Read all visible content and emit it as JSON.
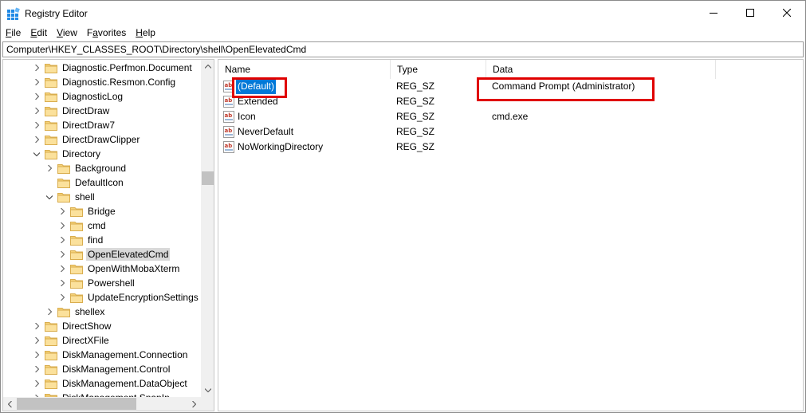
{
  "window": {
    "title": "Registry Editor"
  },
  "menu": [
    {
      "key": "F",
      "rest": "ile"
    },
    {
      "key": "E",
      "rest": "dit"
    },
    {
      "key": "V",
      "rest": "iew"
    },
    {
      "key": "",
      "pre": "F",
      "key2": "a",
      "rest": "vorites"
    },
    {
      "key": "H",
      "rest": "elp"
    }
  ],
  "address": {
    "path": "Computer\\HKEY_CLASSES_ROOT\\Directory\\shell\\OpenElevatedCmd"
  },
  "tree": {
    "items": [
      {
        "label": "Diagnostic.Perfmon.Document",
        "level": 0,
        "chevron": "right"
      },
      {
        "label": "Diagnostic.Resmon.Config",
        "level": 0,
        "chevron": "right"
      },
      {
        "label": "DiagnosticLog",
        "level": 0,
        "chevron": "right"
      },
      {
        "label": "DirectDraw",
        "level": 0,
        "chevron": "right"
      },
      {
        "label": "DirectDraw7",
        "level": 0,
        "chevron": "right"
      },
      {
        "label": "DirectDrawClipper",
        "level": 0,
        "chevron": "right"
      },
      {
        "label": "Directory",
        "level": 0,
        "chevron": "down"
      },
      {
        "label": "Background",
        "level": 1,
        "chevron": "right"
      },
      {
        "label": "DefaultIcon",
        "level": 1,
        "chevron": "none"
      },
      {
        "label": "shell",
        "level": 1,
        "chevron": "down"
      },
      {
        "label": "Bridge",
        "level": 2,
        "chevron": "right"
      },
      {
        "label": "cmd",
        "level": 2,
        "chevron": "right"
      },
      {
        "label": "find",
        "level": 2,
        "chevron": "right"
      },
      {
        "label": "OpenElevatedCmd",
        "level": 2,
        "chevron": "right",
        "selected": true
      },
      {
        "label": "OpenWithMobaXterm",
        "level": 2,
        "chevron": "right"
      },
      {
        "label": "Powershell",
        "level": 2,
        "chevron": "right"
      },
      {
        "label": "UpdateEncryptionSettings",
        "level": 2,
        "chevron": "right"
      },
      {
        "label": "shellex",
        "level": 1,
        "chevron": "right"
      },
      {
        "label": "DirectShow",
        "level": 0,
        "chevron": "right"
      },
      {
        "label": "DirectXFile",
        "level": 0,
        "chevron": "right"
      },
      {
        "label": "DiskManagement.Connection",
        "level": 0,
        "chevron": "right"
      },
      {
        "label": "DiskManagement.Control",
        "level": 0,
        "chevron": "right"
      },
      {
        "label": "DiskManagement.DataObject",
        "level": 0,
        "chevron": "right"
      },
      {
        "label": "DiskManagement.SnapIn",
        "level": 0,
        "chevron": "right"
      }
    ]
  },
  "values": {
    "columns": {
      "name": "Name",
      "type": "Type",
      "data": "Data"
    },
    "rows": [
      {
        "name": "(Default)",
        "type": "REG_SZ",
        "data": "Command Prompt (Administrator)",
        "selected": true
      },
      {
        "name": "Extended",
        "type": "REG_SZ",
        "data": ""
      },
      {
        "name": "Icon",
        "type": "REG_SZ",
        "data": "cmd.exe"
      },
      {
        "name": "NeverDefault",
        "type": "REG_SZ",
        "data": ""
      },
      {
        "name": "NoWorkingDirectory",
        "type": "REG_SZ",
        "data": ""
      }
    ]
  },
  "icons": {
    "app": "registry-editor-icon",
    "folder": "folder-icon",
    "string_value": "string-value-icon",
    "minimize": "minimize-icon",
    "maximize": "maximize-icon",
    "close": "close-icon"
  },
  "colors": {
    "selection": "#0078d7",
    "tree_selection": "#d9d9d9",
    "folder": "#f5d27a",
    "highlight": "#e00000"
  }
}
